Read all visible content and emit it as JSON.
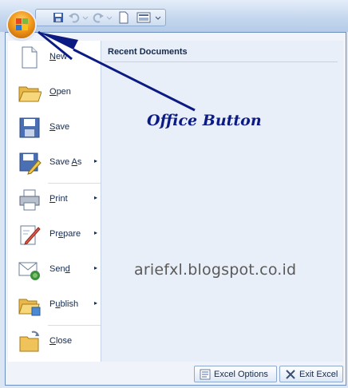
{
  "quick_access": {
    "icons": [
      "save-icon",
      "undo-icon",
      "redo-icon",
      "new-document-icon",
      "print-preview-icon",
      "customize-dropdown-icon"
    ]
  },
  "menu": {
    "items": [
      {
        "label_pre": "",
        "label_u": "N",
        "label_post": "ew",
        "icon": "new-document-icon",
        "submenu": false
      },
      {
        "label_pre": "",
        "label_u": "O",
        "label_post": "pen",
        "icon": "open-folder-icon",
        "submenu": false
      },
      {
        "label_pre": "",
        "label_u": "S",
        "label_post": "ave",
        "icon": "save-disk-icon",
        "submenu": false
      },
      {
        "label_pre": "Save ",
        "label_u": "A",
        "label_post": "s",
        "icon": "save-as-icon",
        "submenu": true
      },
      {
        "label_pre": "",
        "label_u": "P",
        "label_post": "rint",
        "icon": "printer-icon",
        "submenu": true
      },
      {
        "label_pre": "Pr",
        "label_u": "e",
        "label_post": "pare",
        "icon": "prepare-icon",
        "submenu": true
      },
      {
        "label_pre": "Sen",
        "label_u": "d",
        "label_post": "",
        "icon": "send-icon",
        "submenu": true
      },
      {
        "label_pre": "P",
        "label_u": "u",
        "label_post": "blish",
        "icon": "publish-icon",
        "submenu": true
      },
      {
        "label_pre": "",
        "label_u": "C",
        "label_post": "lose",
        "icon": "close-folder-icon",
        "submenu": false
      }
    ],
    "submenu_arrow": "▸"
  },
  "recent_documents": {
    "title": "Recent Documents"
  },
  "footer": {
    "options_label": "Excel Options",
    "exit_label": "Exit Excel"
  },
  "annotation": {
    "text": "Office Button",
    "color": "#0c1b84"
  },
  "watermark": {
    "text": "ariefxl.blogspot.co.id"
  }
}
